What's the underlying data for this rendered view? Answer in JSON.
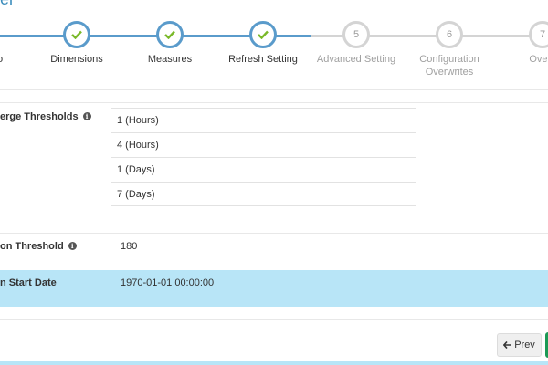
{
  "page": {
    "title": "el"
  },
  "wizard": {
    "steps": [
      {
        "label": "o",
        "status": "done"
      },
      {
        "label": "Dimensions",
        "status": "done"
      },
      {
        "label": "Measures",
        "status": "done"
      },
      {
        "label": "Refresh Setting",
        "status": "done"
      },
      {
        "number": "5",
        "label": "Advanced Setting",
        "status": "todo"
      },
      {
        "number": "6",
        "label": "Configuration Overwrites",
        "status": "todo"
      },
      {
        "number": "7",
        "label": "Overv",
        "status": "todo"
      }
    ]
  },
  "settings": {
    "merge_thresholds": {
      "label": "erge Thresholds",
      "items": [
        "1 (Hours)",
        "4 (Hours)",
        "1 (Days)",
        "7 (Days)"
      ]
    },
    "retention_threshold": {
      "label": "on Threshold",
      "value": "180"
    },
    "partition_start_date": {
      "label": "n Start Date",
      "value": "1970-01-01 00:00:00"
    }
  },
  "footer": {
    "prev_label": "Prev"
  },
  "colors": {
    "accent": "#5a9bcb",
    "check": "#7ab929",
    "highlight": "#b8e5f7",
    "next": "#1c9a55"
  }
}
